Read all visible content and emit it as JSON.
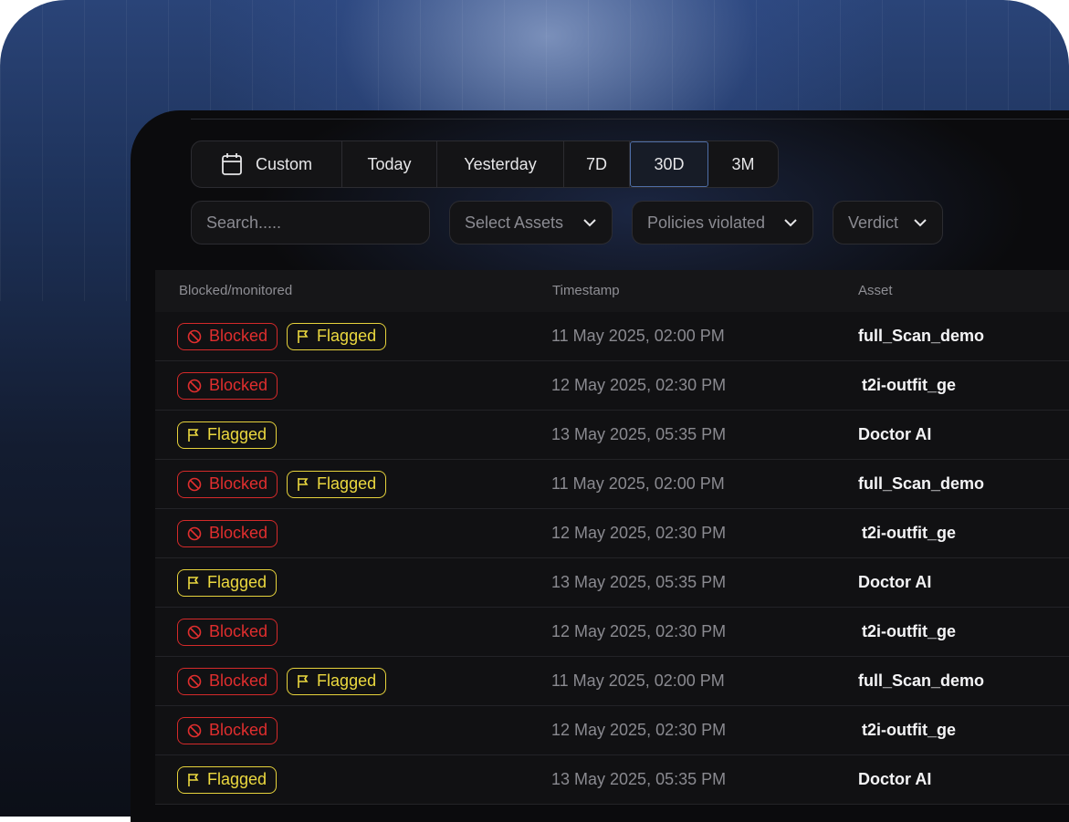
{
  "range_options": [
    {
      "label": "Custom",
      "icon": "calendar-icon",
      "active": false
    },
    {
      "label": "Today",
      "active": false
    },
    {
      "label": "Yesterday",
      "active": false
    },
    {
      "label": "7D",
      "active": false
    },
    {
      "label": "30D",
      "active": true
    },
    {
      "label": "3M",
      "active": false
    }
  ],
  "filters": {
    "search_placeholder": "Search.....",
    "assets_label": "Select Assets",
    "policies_label": "Policies violated",
    "verdict_label": "Verdict"
  },
  "table": {
    "columns": [
      "Blocked/monitored",
      "Timestamp",
      "Asset"
    ],
    "badge_labels": {
      "blocked": "Blocked",
      "flagged": "Flagged"
    },
    "rows": [
      {
        "blocked": true,
        "flagged": true,
        "timestamp": "11 May 2025, 02:00 PM",
        "asset": "full_Scan_demo"
      },
      {
        "blocked": true,
        "flagged": false,
        "timestamp": "12 May 2025, 02:30 PM",
        "asset": "t2i-outfit_ge"
      },
      {
        "blocked": false,
        "flagged": true,
        "timestamp": "13 May 2025, 05:35 PM",
        "asset": "Doctor AI"
      },
      {
        "blocked": true,
        "flagged": true,
        "timestamp": "11 May 2025, 02:00 PM",
        "asset": "full_Scan_demo"
      },
      {
        "blocked": true,
        "flagged": false,
        "timestamp": "12 May 2025, 02:30 PM",
        "asset": "t2i-outfit_ge"
      },
      {
        "blocked": false,
        "flagged": true,
        "timestamp": "13 May 2025, 05:35 PM",
        "asset": "Doctor AI"
      },
      {
        "blocked": true,
        "flagged": false,
        "timestamp": "12 May 2025, 02:30 PM",
        "asset": "t2i-outfit_ge"
      },
      {
        "blocked": true,
        "flagged": true,
        "timestamp": "11 May 2025, 02:00 PM",
        "asset": "full_Scan_demo"
      },
      {
        "blocked": true,
        "flagged": false,
        "timestamp": "12 May 2025, 02:30 PM",
        "asset": "t2i-outfit_ge"
      },
      {
        "blocked": false,
        "flagged": true,
        "timestamp": "13 May 2025, 05:35 PM",
        "asset": "Doctor AI"
      }
    ]
  },
  "colors": {
    "blocked": "#d42a2a",
    "flagged": "#e6d23c",
    "active_border": "#4f6ea8"
  }
}
